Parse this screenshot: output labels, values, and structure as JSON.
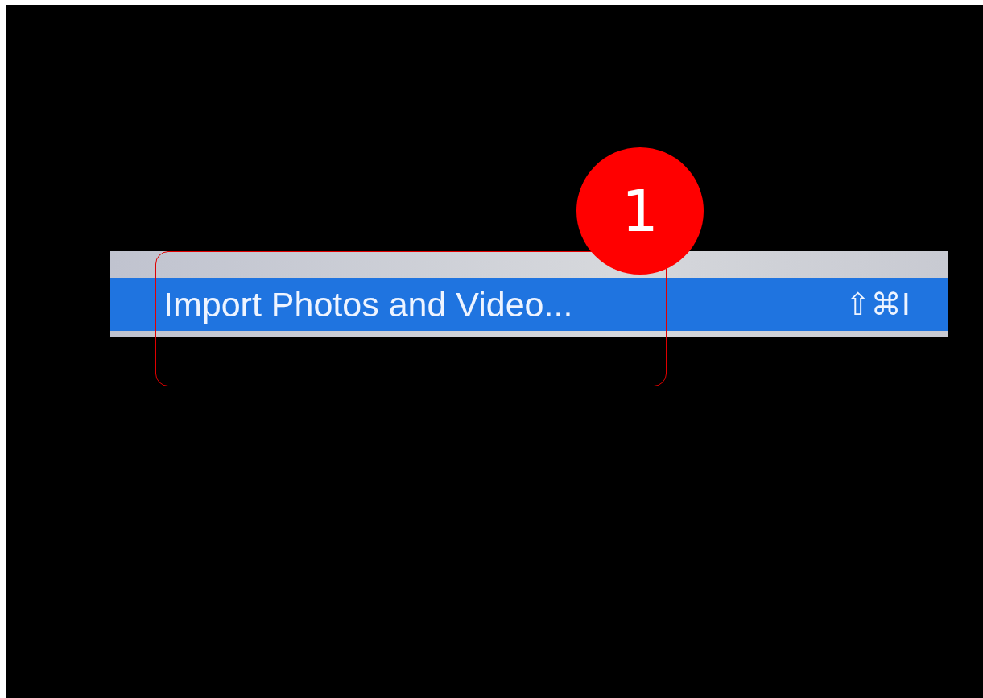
{
  "menu": {
    "items": [
      {
        "label": "Import Photos and Video...",
        "shortcut": "⇧⌘I",
        "selected": true
      }
    ]
  },
  "annotations": [
    {
      "number": "1"
    }
  ]
}
